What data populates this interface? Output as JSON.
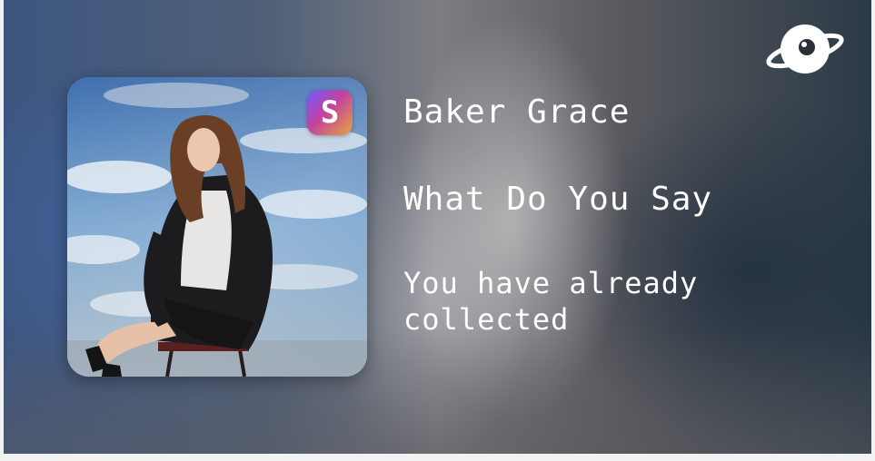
{
  "collectible": {
    "artist": "Baker Grace",
    "track": "What Do You Say",
    "status": "You have already collected"
  },
  "badge": {
    "letter": "S",
    "icon": "platform-s-badge-icon"
  },
  "logo": {
    "icon": "planet-ring-logo-icon"
  },
  "colors": {
    "text": "#ffffff",
    "badge_gradient_start": "#6f5cff",
    "badge_gradient_mid": "#c2429f",
    "badge_gradient_end": "#e7a53b"
  }
}
